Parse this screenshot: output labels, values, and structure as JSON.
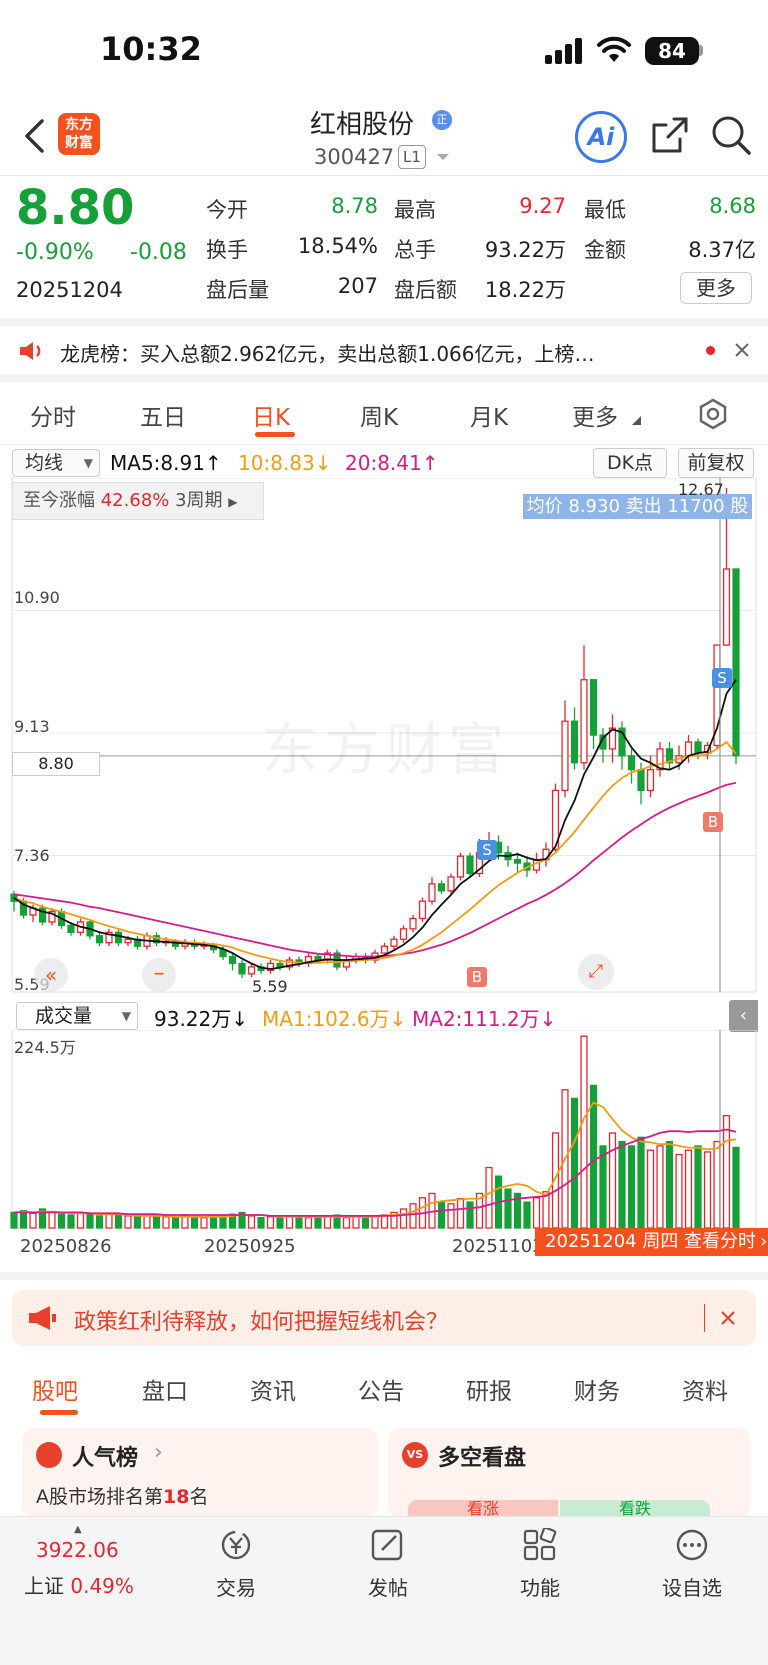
{
  "status_bar": {
    "time": "10:32",
    "battery": "84"
  },
  "header": {
    "title": "红相股份",
    "code": "300427",
    "level_badge": "L1",
    "company_badge": "正",
    "logo_text": "东方财富",
    "ai_label": "Ai"
  },
  "quote": {
    "price": "8.80",
    "change_pct": "-0.90%",
    "change": "-0.08",
    "date": "20251204",
    "fields": [
      {
        "label": "今开",
        "value": "8.78",
        "color": "#15a038"
      },
      {
        "label": "最高",
        "value": "9.27",
        "color": "#e8252f"
      },
      {
        "label": "最低",
        "value": "8.68",
        "color": "#15a038"
      },
      {
        "label": "换手",
        "value": "18.54%",
        "color": "#222222"
      },
      {
        "label": "总手",
        "value": "93.22万",
        "color": "#222222"
      },
      {
        "label": "金额",
        "value": "8.37亿",
        "color": "#222222"
      },
      {
        "label": "盘后量",
        "value": "207",
        "color": "#222222"
      },
      {
        "label": "盘后额",
        "value": "18.22万",
        "color": "#222222"
      }
    ],
    "more_label": "更多"
  },
  "notice": {
    "text": "龙虎榜：买入总额2.962亿元，卖出总额1.066亿元，上榜…"
  },
  "period_tabs": [
    "分时",
    "五日",
    "日K",
    "周K",
    "月K",
    "更多"
  ],
  "chart_toolbar": {
    "indicator": "均线",
    "ma5": "MA5:8.91↑",
    "ma10": "10:8.83↓",
    "ma20": "20:8.41↑",
    "dk": "DK点",
    "adjust": "前复权",
    "since_label": "至今涨幅",
    "since_value": "42.68%",
    "since_period": "3周期",
    "avg_banner": "均价 8.930 卖出 11700 股",
    "hi_mark": "12.67",
    "lo_mark": "5.59",
    "y_labels": [
      "10.90",
      "9.13",
      "7.36",
      "5.59"
    ],
    "current_price": "8.80",
    "signals": {
      "S": "S",
      "B": "B"
    },
    "watermark": "东方财富"
  },
  "volume_toolbar": {
    "indicator": "成交量",
    "vol": "93.22万↓",
    "ma1": "MA1:102.6万↓",
    "ma2": "MA2:111.2万↓",
    "max_label": "224.5万"
  },
  "x_labels": [
    "20250826",
    "20250925",
    "20251103"
  ],
  "date_tag": "20251204 周四 查看分时",
  "promo": {
    "text": "政策红利待释放，如何把握短线机会？"
  },
  "bottom_tabs": [
    "股吧",
    "盘口",
    "资讯",
    "公告",
    "研报",
    "财务",
    "资料"
  ],
  "cards": {
    "popularity_title": "人气榜",
    "popularity_rank_prefix": "A股市场排名第",
    "popularity_rank": "18",
    "popularity_rank_suffix": "名",
    "longshort_title": "多空看盘",
    "bull": "看涨",
    "bear": "看跌"
  },
  "bottom_nav": {
    "index_value": "3922.06",
    "index_name": "上证",
    "index_change": "0.49%",
    "items": [
      "交易",
      "发帖",
      "功能",
      "设自选"
    ]
  },
  "colors": {
    "up": "#e8252f",
    "down": "#15a038",
    "accent": "#f4511e",
    "ma5": "#111111",
    "ma10": "#f39c12",
    "ma20": "#d81b8c"
  },
  "chart_data": {
    "type": "candlestick",
    "ylim": [
      5.59,
      12.67
    ],
    "candles": [
      [
        6.8,
        6.7,
        6.85,
        6.55
      ],
      [
        6.7,
        6.5,
        6.75,
        6.45
      ],
      [
        6.5,
        6.6,
        6.65,
        6.4
      ],
      [
        6.6,
        6.4,
        6.65,
        6.35
      ],
      [
        6.4,
        6.55,
        6.6,
        6.35
      ],
      [
        6.55,
        6.35,
        6.6,
        6.3
      ],
      [
        6.35,
        6.25,
        6.4,
        6.2
      ],
      [
        6.25,
        6.4,
        6.45,
        6.2
      ],
      [
        6.4,
        6.2,
        6.42,
        6.15
      ],
      [
        6.2,
        6.1,
        6.25,
        6.05
      ],
      [
        6.1,
        6.25,
        6.3,
        6.05
      ],
      [
        6.25,
        6.1,
        6.3,
        6.05
      ],
      [
        6.1,
        6.15,
        6.2,
        6.05
      ],
      [
        6.15,
        6.05,
        6.2,
        6.0
      ],
      [
        6.05,
        6.2,
        6.25,
        6.0
      ],
      [
        6.2,
        6.1,
        6.25,
        6.05
      ],
      [
        6.1,
        6.12,
        6.18,
        6.05
      ],
      [
        6.12,
        6.05,
        6.15,
        6.0
      ],
      [
        6.05,
        6.1,
        6.15,
        6.0
      ],
      [
        6.1,
        6.05,
        6.15,
        6.0
      ],
      [
        6.05,
        6.08,
        6.12,
        6.0
      ],
      [
        6.08,
        6.0,
        6.1,
        5.95
      ],
      [
        6.0,
        5.9,
        6.05,
        5.85
      ],
      [
        5.9,
        5.8,
        5.95,
        5.7
      ],
      [
        5.8,
        5.65,
        5.85,
        5.59
      ],
      [
        5.65,
        5.75,
        5.8,
        5.6
      ],
      [
        5.75,
        5.7,
        5.8,
        5.65
      ],
      [
        5.7,
        5.8,
        5.85,
        5.65
      ],
      [
        5.8,
        5.75,
        5.85,
        5.7
      ],
      [
        5.75,
        5.85,
        5.9,
        5.7
      ],
      [
        5.85,
        5.8,
        5.9,
        5.75
      ],
      [
        5.8,
        5.9,
        5.95,
        5.75
      ],
      [
        5.9,
        5.85,
        5.95,
        5.8
      ],
      [
        5.85,
        5.95,
        6.0,
        5.8
      ],
      [
        5.95,
        5.75,
        6.0,
        5.7
      ],
      [
        5.75,
        5.85,
        5.9,
        5.7
      ],
      [
        5.85,
        5.9,
        5.95,
        5.8
      ],
      [
        5.9,
        5.85,
        5.95,
        5.8
      ],
      [
        5.85,
        5.95,
        6.0,
        5.8
      ],
      [
        5.95,
        6.05,
        6.1,
        5.9
      ],
      [
        6.05,
        6.15,
        6.2,
        6.0
      ],
      [
        6.15,
        6.3,
        6.35,
        6.1
      ],
      [
        6.3,
        6.45,
        6.5,
        6.25
      ],
      [
        6.45,
        6.7,
        6.75,
        6.4
      ],
      [
        6.7,
        6.95,
        7.05,
        6.65
      ],
      [
        6.95,
        6.85,
        7.0,
        6.8
      ],
      [
        6.85,
        7.05,
        7.1,
        6.8
      ],
      [
        7.05,
        7.35,
        7.4,
        7.0
      ],
      [
        7.35,
        7.1,
        7.4,
        7.05
      ],
      [
        7.1,
        7.4,
        7.6,
        7.05
      ],
      [
        7.4,
        7.55,
        7.7,
        7.35
      ],
      [
        7.55,
        7.4,
        7.65,
        7.3
      ],
      [
        7.4,
        7.3,
        7.5,
        7.2
      ],
      [
        7.3,
        7.25,
        7.4,
        7.1
      ],
      [
        7.25,
        7.15,
        7.35,
        7.05
      ],
      [
        7.15,
        7.3,
        7.4,
        7.1
      ],
      [
        7.3,
        7.45,
        7.55,
        7.2
      ],
      [
        7.45,
        8.3,
        8.4,
        7.4
      ],
      [
        8.3,
        9.3,
        9.6,
        8.2
      ],
      [
        9.3,
        8.7,
        9.5,
        8.6
      ],
      [
        8.7,
        9.9,
        10.4,
        8.6
      ],
      [
        9.9,
        9.1,
        9.3,
        8.9
      ],
      [
        9.1,
        8.9,
        9.2,
        8.7
      ],
      [
        8.9,
        9.2,
        9.4,
        8.7
      ],
      [
        9.2,
        8.8,
        9.3,
        8.6
      ],
      [
        8.8,
        8.6,
        8.9,
        8.4
      ],
      [
        8.6,
        8.3,
        8.7,
        8.1
      ],
      [
        8.3,
        8.6,
        8.8,
        8.2
      ],
      [
        8.6,
        8.9,
        9.0,
        8.5
      ],
      [
        8.9,
        8.7,
        9.0,
        8.6
      ],
      [
        8.7,
        8.8,
        8.95,
        8.6
      ],
      [
        8.8,
        9.0,
        9.1,
        8.7
      ],
      [
        9.0,
        8.85,
        9.05,
        8.75
      ],
      [
        8.85,
        8.95,
        9.0,
        8.75
      ],
      [
        8.95,
        10.4,
        10.4,
        8.9
      ],
      [
        10.4,
        11.5,
        12.67,
        10.6
      ],
      [
        11.5,
        8.8,
        9.27,
        8.68
      ]
    ],
    "ma5": [
      6.75,
      6.65,
      6.6,
      6.55,
      6.52,
      6.45,
      6.38,
      6.33,
      6.3,
      6.25,
      6.22,
      6.2,
      6.17,
      6.14,
      6.13,
      6.12,
      6.11,
      6.1,
      6.09,
      6.08,
      6.07,
      6.05,
      6.01,
      5.95,
      5.87,
      5.8,
      5.74,
      5.72,
      5.74,
      5.77,
      5.79,
      5.82,
      5.84,
      5.86,
      5.85,
      5.85,
      5.86,
      5.87,
      5.88,
      5.92,
      5.99,
      6.07,
      6.18,
      6.32,
      6.5,
      6.65,
      6.79,
      6.95,
      7.05,
      7.16,
      7.28,
      7.36,
      7.35,
      7.38,
      7.33,
      7.29,
      7.31,
      7.49,
      7.87,
      8.15,
      8.53,
      8.78,
      9.06,
      9.18,
      9.14,
      8.92,
      8.76,
      8.7,
      8.62,
      8.6,
      8.66,
      8.8,
      8.84,
      8.86,
      9.2,
      9.7,
      9.9
    ],
    "ma10": [
      6.75,
      6.7,
      6.67,
      6.62,
      6.58,
      6.55,
      6.51,
      6.47,
      6.43,
      6.38,
      6.34,
      6.3,
      6.26,
      6.23,
      6.2,
      6.17,
      6.15,
      6.13,
      6.11,
      6.1,
      6.09,
      6.08,
      6.06,
      6.03,
      5.98,
      5.94,
      5.9,
      5.87,
      5.84,
      5.82,
      5.81,
      5.81,
      5.81,
      5.82,
      5.82,
      5.83,
      5.84,
      5.85,
      5.86,
      5.88,
      5.91,
      5.95,
      6.0,
      6.07,
      6.16,
      6.25,
      6.36,
      6.47,
      6.58,
      6.7,
      6.82,
      6.93,
      7.02,
      7.11,
      7.19,
      7.25,
      7.3,
      7.4,
      7.55,
      7.7,
      7.88,
      8.05,
      8.22,
      8.37,
      8.48,
      8.56,
      8.6,
      8.65,
      8.68,
      8.72,
      8.76,
      8.8,
      8.8,
      8.82,
      8.9,
      9.0,
      8.83
    ],
    "ma20": [
      6.8,
      6.78,
      6.76,
      6.74,
      6.72,
      6.7,
      6.68,
      6.65,
      6.62,
      6.6,
      6.57,
      6.54,
      6.51,
      6.48,
      6.45,
      6.42,
      6.39,
      6.36,
      6.33,
      6.3,
      6.27,
      6.24,
      6.21,
      6.18,
      6.15,
      6.12,
      6.09,
      6.06,
      6.03,
      6.0,
      5.98,
      5.96,
      5.94,
      5.93,
      5.92,
      5.91,
      5.9,
      5.9,
      5.9,
      5.91,
      5.92,
      5.94,
      5.96,
      5.99,
      6.03,
      6.07,
      6.12,
      6.18,
      6.24,
      6.31,
      6.38,
      6.45,
      6.52,
      6.59,
      6.66,
      6.72,
      6.79,
      6.87,
      6.96,
      7.06,
      7.17,
      7.29,
      7.4,
      7.51,
      7.62,
      7.72,
      7.81,
      7.9,
      7.98,
      8.05,
      8.11,
      8.17,
      8.22,
      8.27,
      8.33,
      8.38,
      8.41
    ],
    "volume": [
      18,
      20,
      17,
      22,
      18,
      16,
      15,
      18,
      17,
      14,
      16,
      15,
      14,
      13,
      15,
      14,
      13,
      12,
      14,
      13,
      12,
      14,
      15,
      16,
      18,
      14,
      12,
      13,
      12,
      14,
      13,
      12,
      13,
      14,
      15,
      12,
      13,
      14,
      13,
      15,
      18,
      22,
      28,
      35,
      40,
      30,
      28,
      34,
      30,
      40,
      70,
      60,
      45,
      40,
      30,
      35,
      42,
      110,
      160,
      150,
      222,
      165,
      95,
      110,
      100,
      95,
      105,
      90,
      95,
      100,
      85,
      90,
      95,
      88,
      100,
      130,
      93.22
    ],
    "vol_ma1": [
      18,
      19,
      18,
      19,
      19,
      18,
      17,
      17,
      17,
      16,
      16,
      16,
      15,
      14,
      14,
      14,
      14,
      13,
      13,
      13,
      13,
      13,
      13,
      14,
      15,
      15,
      15,
      14,
      13,
      13,
      13,
      13,
      13,
      13,
      13,
      13,
      13,
      13,
      13,
      14,
      15,
      16,
      19,
      24,
      29,
      31,
      32,
      33,
      34,
      34,
      40,
      46,
      49,
      51,
      49,
      42,
      38,
      58,
      80,
      100,
      127,
      145,
      140,
      126,
      113,
      105,
      100,
      99,
      97,
      97,
      95,
      93,
      93,
      91,
      92,
      101,
      102.6
    ],
    "vol_ma2": [
      18,
      18,
      18,
      18,
      18,
      18,
      18,
      18,
      17,
      17,
      17,
      17,
      16,
      16,
      16,
      16,
      15,
      15,
      15,
      15,
      15,
      15,
      15,
      15,
      15,
      15,
      15,
      14,
      14,
      14,
      14,
      14,
      14,
      14,
      14,
      14,
      14,
      14,
      14,
      14,
      14,
      15,
      16,
      17,
      19,
      20,
      21,
      22,
      23,
      24,
      27,
      30,
      32,
      34,
      35,
      36,
      37,
      43,
      50,
      58,
      68,
      78,
      84,
      90,
      95,
      99,
      103,
      106,
      110,
      112,
      112,
      111,
      112,
      112,
      112,
      114,
      111.2
    ]
  }
}
